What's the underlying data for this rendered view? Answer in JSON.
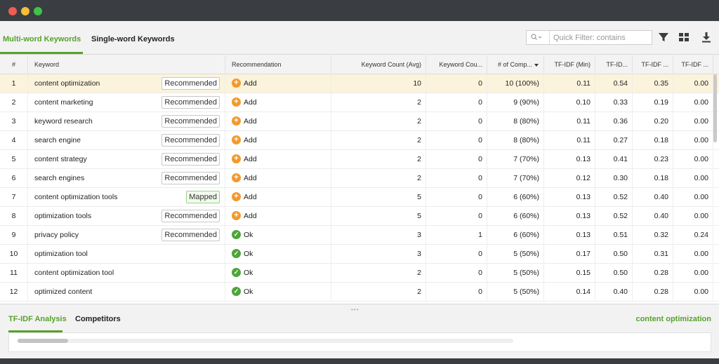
{
  "tabs": {
    "multi": "Multi-word Keywords",
    "single": "Single-word Keywords"
  },
  "filter": {
    "placeholder": "Quick Filter: contains"
  },
  "icons": {
    "search": "search-icon",
    "filter": "funnel-icon",
    "layout": "grid-layout-icon",
    "download": "download-icon"
  },
  "colors": {
    "accent": "#56a22a",
    "add": "#f29a2e",
    "ok": "#4ea53a",
    "selected_row": "#fbf3dc"
  },
  "columns": {
    "num": "#",
    "keyword": "Keyword",
    "recommendation": "Recommendation",
    "kc_avg": "Keyword Count (Avg)",
    "kc2": "Keyword Cou...",
    "comp": "# of Comp...",
    "tfidf_min": "TF-IDF (Min)",
    "tfidf2": "TF-ID...",
    "tfidf3": "TF-IDF ...",
    "tfidf4": "TF-IDF ..."
  },
  "rows": [
    {
      "num": "1",
      "keyword": "content optimization",
      "badge": "Recommended",
      "rec": "Add",
      "kc": "10",
      "kc2": "0",
      "comp": "10 (100%)",
      "t1": "0.11",
      "t2": "0.54",
      "t3": "0.35",
      "t4": "0.00"
    },
    {
      "num": "2",
      "keyword": "content marketing",
      "badge": "Recommended",
      "rec": "Add",
      "kc": "2",
      "kc2": "0",
      "comp": "9 (90%)",
      "t1": "0.10",
      "t2": "0.33",
      "t3": "0.19",
      "t4": "0.00"
    },
    {
      "num": "3",
      "keyword": "keyword research",
      "badge": "Recommended",
      "rec": "Add",
      "kc": "2",
      "kc2": "0",
      "comp": "8 (80%)",
      "t1": "0.11",
      "t2": "0.36",
      "t3": "0.20",
      "t4": "0.00"
    },
    {
      "num": "4",
      "keyword": "search engine",
      "badge": "Recommended",
      "rec": "Add",
      "kc": "2",
      "kc2": "0",
      "comp": "8 (80%)",
      "t1": "0.11",
      "t2": "0.27",
      "t3": "0.18",
      "t4": "0.00"
    },
    {
      "num": "5",
      "keyword": "content strategy",
      "badge": "Recommended",
      "rec": "Add",
      "kc": "2",
      "kc2": "0",
      "comp": "7 (70%)",
      "t1": "0.13",
      "t2": "0.41",
      "t3": "0.23",
      "t4": "0.00"
    },
    {
      "num": "6",
      "keyword": "search engines",
      "badge": "Recommended",
      "rec": "Add",
      "kc": "2",
      "kc2": "0",
      "comp": "7 (70%)",
      "t1": "0.12",
      "t2": "0.30",
      "t3": "0.18",
      "t4": "0.00"
    },
    {
      "num": "7",
      "keyword": "content optimization tools",
      "badge": "Mapped",
      "rec": "Add",
      "kc": "5",
      "kc2": "0",
      "comp": "6 (60%)",
      "t1": "0.13",
      "t2": "0.52",
      "t3": "0.40",
      "t4": "0.00"
    },
    {
      "num": "8",
      "keyword": "optimization tools",
      "badge": "Recommended",
      "rec": "Add",
      "kc": "5",
      "kc2": "0",
      "comp": "6 (60%)",
      "t1": "0.13",
      "t2": "0.52",
      "t3": "0.40",
      "t4": "0.00"
    },
    {
      "num": "9",
      "keyword": "privacy policy",
      "badge": "Recommended",
      "rec": "Ok",
      "kc": "3",
      "kc2": "1",
      "comp": "6 (60%)",
      "t1": "0.13",
      "t2": "0.51",
      "t3": "0.32",
      "t4": "0.24"
    },
    {
      "num": "10",
      "keyword": "optimization tool",
      "badge": "",
      "rec": "Ok",
      "kc": "3",
      "kc2": "0",
      "comp": "5 (50%)",
      "t1": "0.17",
      "t2": "0.50",
      "t3": "0.31",
      "t4": "0.00"
    },
    {
      "num": "11",
      "keyword": "content optimization tool",
      "badge": "",
      "rec": "Ok",
      "kc": "2",
      "kc2": "0",
      "comp": "5 (50%)",
      "t1": "0.15",
      "t2": "0.50",
      "t3": "0.28",
      "t4": "0.00"
    },
    {
      "num": "12",
      "keyword": "optimized content",
      "badge": "",
      "rec": "Ok",
      "kc": "2",
      "kc2": "0",
      "comp": "5 (50%)",
      "t1": "0.14",
      "t2": "0.40",
      "t3": "0.28",
      "t4": "0.00"
    }
  ],
  "bottom": {
    "tab_tfidf": "TF-IDF Analysis",
    "tab_competitors": "Competitors",
    "selected_keyword": "content optimization"
  }
}
